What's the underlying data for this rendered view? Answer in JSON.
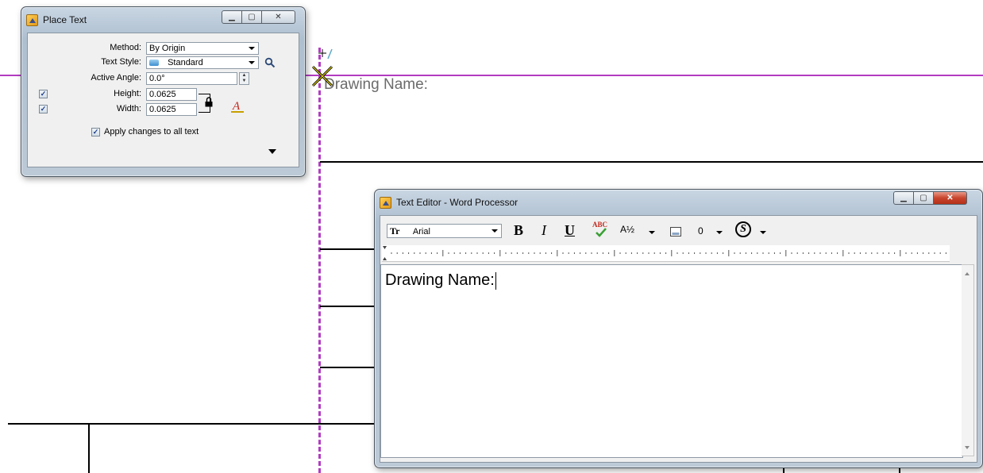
{
  "canvas": {
    "drawing_label": "Drawing Name:",
    "colors": {
      "magenta": "#b23cc2",
      "lines": "#000000"
    }
  },
  "place_text": {
    "title": "Place Text",
    "method_label": "Method:",
    "method_value": "By Origin",
    "text_style_label": "Text Style:",
    "text_style_value": "Standard",
    "active_angle_label": "Active Angle:",
    "active_angle_value": "0.0°",
    "height_label": "Height:",
    "height_value": "0.0625",
    "width_label": "Width:",
    "width_value": "0.0625",
    "apply_label": "Apply changes to all text",
    "height_checked": "✓",
    "width_checked": "✓",
    "apply_checked": "✓"
  },
  "text_editor": {
    "title": "Text Editor - Word Processor",
    "font_value": "Arial",
    "font_icon_label": "Tr",
    "bold_label": "B",
    "italic_label": "I",
    "underline_label": "U",
    "spell_label": "ABC",
    "fraction_label": "A½",
    "spacing_value": "0",
    "special_char_label": "S",
    "content": "Drawing Name:"
  }
}
